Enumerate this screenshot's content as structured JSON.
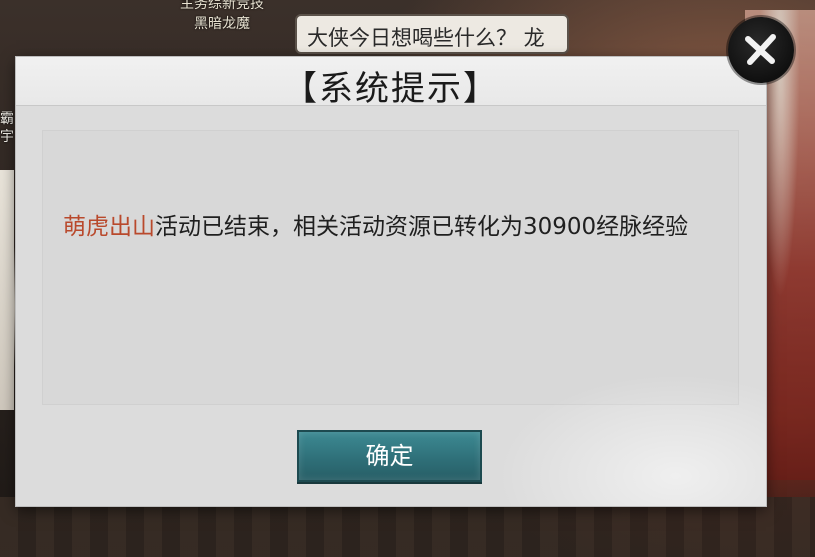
{
  "background": {
    "npc_names": [
      "主务综新竞技",
      "黑暗龙魔"
    ],
    "side_text": "霸宇",
    "chat_bubble": "大侠今日想喝些什么？ 龙"
  },
  "dialog": {
    "title": "【系统提示】",
    "message": {
      "highlight": "萌虎出山",
      "text": "活动已结束，相关活动资源已转化为30900经脉经验"
    },
    "confirm_label": "确定"
  },
  "colors": {
    "highlight": "#b9492c",
    "button": "#2f7079",
    "dialog_bg": "#dcdcdc"
  },
  "icons": {
    "close": "close-icon"
  }
}
